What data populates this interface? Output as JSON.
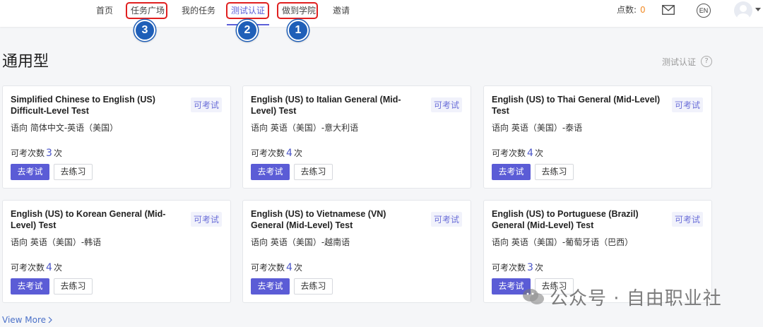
{
  "nav": {
    "items": [
      {
        "label": "首页"
      },
      {
        "label": "任务广场"
      },
      {
        "label": "我的任务"
      },
      {
        "label": "测试认证"
      },
      {
        "label": "做到学院"
      },
      {
        "label": "邀请"
      }
    ],
    "active_index": 3,
    "annotations": [
      "3",
      "2",
      "1"
    ]
  },
  "header": {
    "points_label": "点数:",
    "points_value": "0",
    "lang": "EN"
  },
  "page": {
    "title": "通用型",
    "cert_link": "测试认证",
    "help": "?"
  },
  "cards": [
    {
      "title": "Simplified Chinese to English (US) Difficult-Level Test",
      "tag": "可考试",
      "direction": "语向 简体中文-英语（美国）",
      "count_prefix": "可考次数",
      "count": "3",
      "count_suffix": "次",
      "exam": "去考试",
      "practice": "去练习"
    },
    {
      "title": "English (US) to Italian General (Mid-Level) Test",
      "tag": "可考试",
      "direction": "语向 英语（美国）-意大利语",
      "count_prefix": "可考次数",
      "count": "4",
      "count_suffix": "次",
      "exam": "去考试",
      "practice": "去练习"
    },
    {
      "title": "English (US) to Thai General (Mid-Level) Test",
      "tag": "可考试",
      "direction": "语向 英语（美国）-泰语",
      "count_prefix": "可考次数",
      "count": "4",
      "count_suffix": "次",
      "exam": "去考试",
      "practice": "去练习"
    },
    {
      "title": "English (US) to Korean General (Mid-Level) Test",
      "tag": "可考试",
      "direction": "语向 英语（美国）-韩语",
      "count_prefix": "可考次数",
      "count": "4",
      "count_suffix": "次",
      "exam": "去考试",
      "practice": "去练习"
    },
    {
      "title": "English (US) to Vietnamese (VN) General (Mid-Level) Test",
      "tag": "可考试",
      "direction": "语向 英语（美国）-越南语",
      "count_prefix": "可考次数",
      "count": "4",
      "count_suffix": "次",
      "exam": "去考试",
      "practice": "去练习"
    },
    {
      "title": "English (US) to Portuguese (Brazil) General (Mid-Level) Test",
      "tag": "可考试",
      "direction": "语向 英语（美国）-葡萄牙语（巴西）",
      "count_prefix": "可考次数",
      "count": "3",
      "count_suffix": "次",
      "exam": "去考试",
      "practice": "去练习"
    }
  ],
  "view_more": "View More",
  "watermark": "公众号 · 自由职业社",
  "colors": {
    "accent": "#5b5cd6",
    "annotation_red": "#e02020",
    "badge_blue": "#1f5fb8",
    "points": "#f28c28"
  }
}
